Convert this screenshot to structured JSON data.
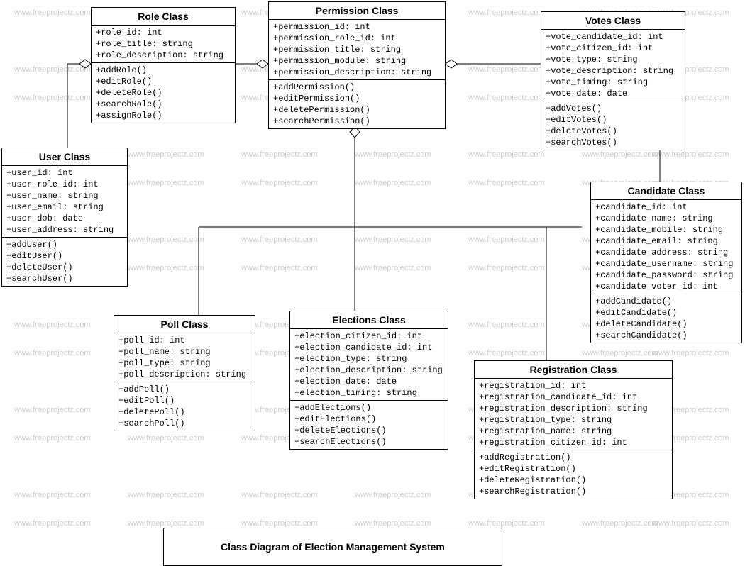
{
  "watermark_text": "www.freeprojectz.com",
  "diagram_title": "Class Diagram of Election Management System",
  "classes": {
    "role": {
      "title": "Role Class",
      "attrs": [
        "+role_id: int",
        "+role_title: string",
        "+role_description: string"
      ],
      "ops": [
        "+addRole()",
        "+editRole()",
        "+deleteRole()",
        "+searchRole()",
        "+assignRole()"
      ]
    },
    "permission": {
      "title": "Permission Class",
      "attrs": [
        "+permission_id: int",
        "+permission_role_id: int",
        "+permission_title: string",
        "+permission_module: string",
        "+permission_description: string"
      ],
      "ops": [
        "+addPermission()",
        "+editPermission()",
        "+deletePermission()",
        "+searchPermission()"
      ]
    },
    "votes": {
      "title": "Votes Class",
      "attrs": [
        "+vote_candidate_id: int",
        "+vote_citizen_id: int",
        "+vote_type: string",
        "+vote_description: string",
        "+vote_timing: string",
        "+vote_date: date"
      ],
      "ops": [
        "+addVotes()",
        "+editVotes()",
        "+deleteVotes()",
        "+searchVotes()"
      ]
    },
    "user": {
      "title": "User Class",
      "attrs": [
        "+user_id: int",
        "+user_role_id: int",
        "+user_name: string",
        "+user_email: string",
        "+user_dob: date",
        "+user_address: string"
      ],
      "ops": [
        "+addUser()",
        "+editUser()",
        "+deleteUser()",
        "+searchUser()"
      ]
    },
    "candidate": {
      "title": "Candidate Class",
      "attrs": [
        "+candidate_id: int",
        "+candidate_name: string",
        "+candidate_mobile: string",
        "+candidate_email: string",
        "+candidate_address: string",
        "+candidate_username: string",
        "+candidate_password: string",
        "+candidate_voter_id: int"
      ],
      "ops": [
        "+addCandidate()",
        "+editCandidate()",
        "+deleteCandidate()",
        "+searchCandidate()"
      ]
    },
    "poll": {
      "title": "Poll Class",
      "attrs": [
        "+poll_id: int",
        "+poll_name: string",
        "+poll_type: string",
        "+poll_description: string"
      ],
      "ops": [
        "+addPoll()",
        "+editPoll()",
        "+deletePoll()",
        "+searchPoll()"
      ]
    },
    "elections": {
      "title": "Elections Class",
      "attrs": [
        "+election_citizen_id: int",
        "+election_candidate_id: int",
        "+election_type: string",
        "+election_description: string",
        "+election_date: date",
        "+election_timing: string"
      ],
      "ops": [
        "+addElections()",
        "+editElections()",
        "+deleteElections()",
        "+searchElections()"
      ]
    },
    "registration": {
      "title": "Registration Class",
      "attrs": [
        "+registration_id: int",
        "+registration_candidate_id: int",
        "+registration_description: string",
        "+registration_type: string",
        "+registration_name: string",
        "+registration_citizen_id: int"
      ],
      "ops": [
        "+addRegistration()",
        "+editRegistration()",
        "+deleteRegistration()",
        "+searchRegistration()"
      ]
    }
  }
}
